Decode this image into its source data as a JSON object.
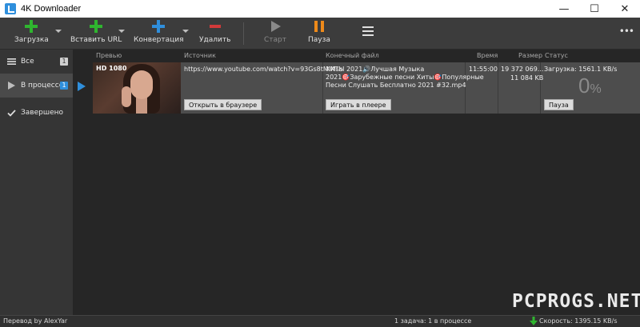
{
  "window": {
    "title": "4K Downloader",
    "minimize_glyph": "—",
    "maximize_glyph": "☐",
    "close_glyph": "✕"
  },
  "toolbar": {
    "download_label": "Загрузка",
    "paste_url_label": "Вставить URL",
    "convert_label": "Конвертация",
    "delete_label": "Удалить",
    "start_label": "Старт",
    "pause_label": "Пауза",
    "more_glyph": "•••",
    "colors": {
      "green": "#2fb52f",
      "blue": "#2f8fdc",
      "red": "#d23a3a",
      "orange": "#ee8a1a",
      "gray": "#8a8a8a"
    }
  },
  "sidebar": {
    "items": [
      {
        "label": "Все",
        "count": "1",
        "icon": "list-icon"
      },
      {
        "label": "В процессе",
        "count": "1",
        "icon": "play-icon"
      },
      {
        "label": "Завершено",
        "icon": "check-icon"
      }
    ]
  },
  "columns": {
    "preview": "Превью",
    "source": "Источник",
    "target": "Конечный файл",
    "time": "Время",
    "size": "Размер",
    "status": "Статус"
  },
  "download": {
    "quality": "HD 1080",
    "url": "https://www.youtube.com/watch?v=93Gs8tMlMss",
    "open_browser": "Открыть в браузере",
    "filename_1": "ХИТЫ 2021🔊Лучшая Музыка",
    "filename_2": "2021🎯Зарубежные песни Хиты🎯Популярные",
    "filename_3": "Песни Слушать Бесплатно 2021 #32.mp4",
    "play_player": "Играть в плеере",
    "time": "11:55:00",
    "size_total": "19 372 069...",
    "size_done": "11 084 KB",
    "status": "Загрузка: 1561.1 KB/s",
    "percent": "0",
    "percent_sign": "%",
    "pause": "Пауза",
    "progress": 0
  },
  "statusbar": {
    "translator": "Перевод by AlexYar",
    "tasks": "1 задача: 1 в процессе",
    "speed": "Скорость: 1395.15 KB/s"
  },
  "watermark": "PCPROGS.NET"
}
